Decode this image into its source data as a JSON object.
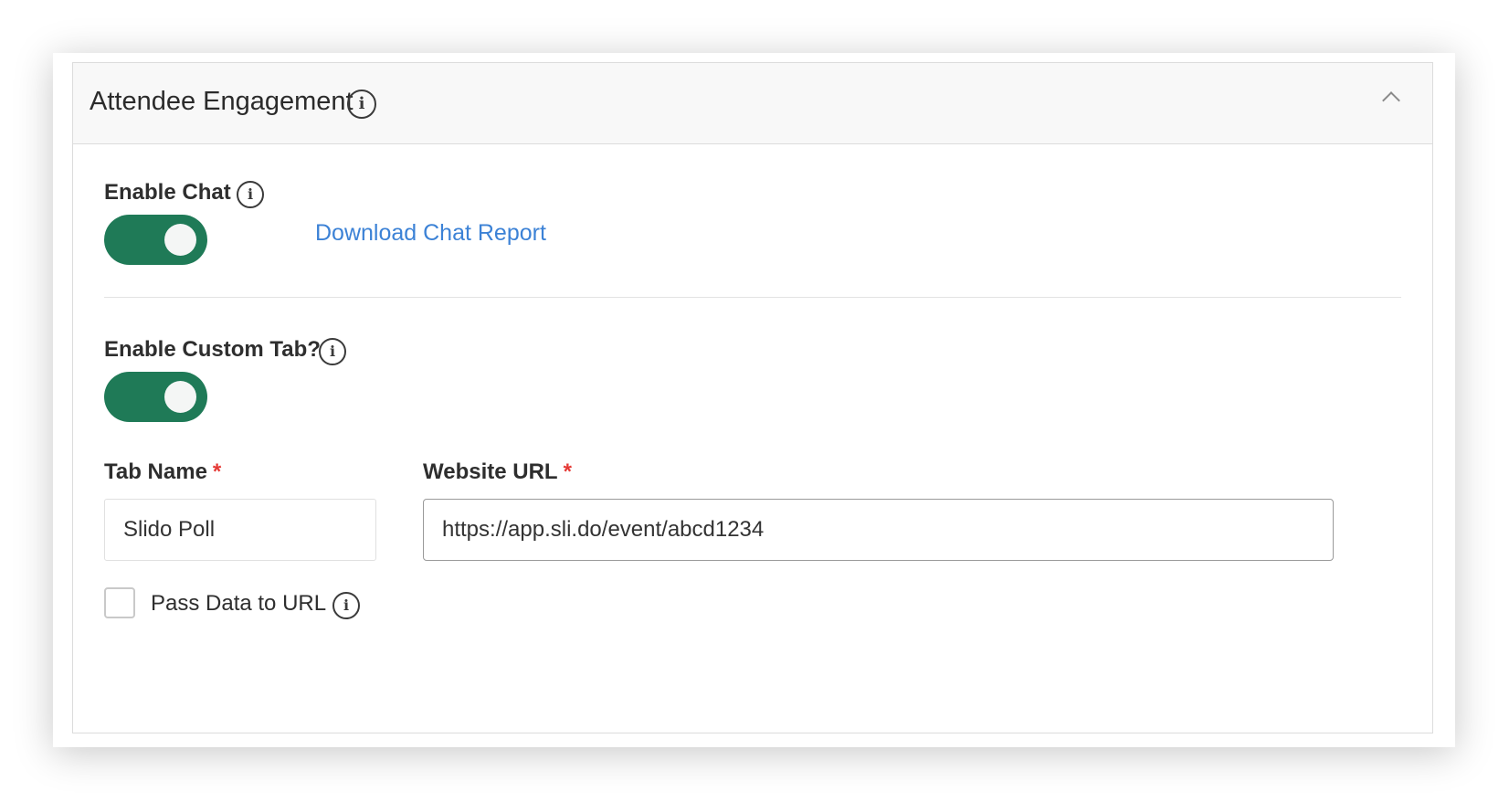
{
  "section": {
    "title": "Attendee Engagement",
    "collapsed": false,
    "header_icons": [
      "info-icon",
      "chevron-up-icon"
    ]
  },
  "chat": {
    "label": "Enable Chat",
    "enabled": true,
    "download_link": "Download Chat Report"
  },
  "custom_tab": {
    "label": "Enable Custom Tab?",
    "enabled": true
  },
  "tab_name": {
    "label": "Tab Name",
    "required_marker": "*",
    "value": "Slido Poll"
  },
  "website_url": {
    "label": "Website URL",
    "required_marker": "*",
    "value": "https://app.sli.do/event/abcd1234"
  },
  "pass_data": {
    "label": "Pass Data to URL",
    "checked": false
  },
  "colors": {
    "toggle_on": "#1f7a57",
    "link": "#3c82d6",
    "required": "#e53935",
    "header_bg": "#f8f8f8"
  }
}
